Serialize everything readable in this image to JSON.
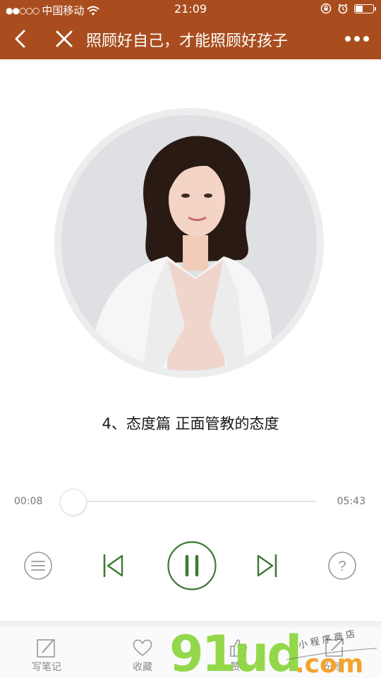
{
  "status_bar": {
    "carrier": "中国移动",
    "time": "21:09"
  },
  "navbar": {
    "title": "照顾好自己，才能照顾好孩子"
  },
  "player": {
    "track_title": "4、态度篇 正面管教的态度",
    "current_time": "00:08",
    "total_time": "05:43",
    "progress_fraction": 0.023
  },
  "tabbar": {
    "items": [
      {
        "label": "写笔记",
        "icon": "note-edit-icon"
      },
      {
        "label": "收藏",
        "icon": "heart-icon"
      },
      {
        "label": "赞0",
        "icon": "thumb-up-icon"
      },
      {
        "label": "分享",
        "icon": "share-icon"
      }
    ]
  },
  "watermark": {
    "text": "91ud.com",
    "script": "小程序商店"
  },
  "colors": {
    "header": "#a94d1f",
    "accent": "#3d7a32",
    "watermark": "#8bd63c"
  }
}
